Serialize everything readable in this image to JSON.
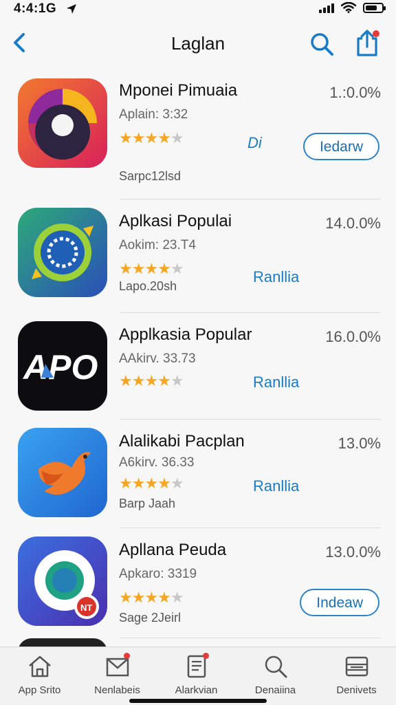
{
  "status": {
    "time": "4:4:1G"
  },
  "nav": {
    "title": "Laglan"
  },
  "apps": [
    {
      "name": "Mponei Pimuaia",
      "subtitle": "Aplain: 3:32",
      "rating": 4,
      "extra": "Sarpc12lsd",
      "size": "1.:0.0%",
      "action_type": "both",
      "action_link": "Di",
      "action_button": "Iedarw"
    },
    {
      "name": "Aplkasi Populai",
      "subtitle": "Aokim: 23.T4",
      "rating": 4,
      "extra": "Lapo.20sh",
      "size": "14.0.0%",
      "action_type": "link",
      "action_link": "Ranllia",
      "action_button": ""
    },
    {
      "name": "Applkasia Popular",
      "subtitle": "AAkirv. 33.73",
      "rating": 4,
      "extra": "",
      "size": "16.0.0%",
      "action_type": "link",
      "action_link": "Ranllia",
      "action_button": ""
    },
    {
      "name": "Alalikabi Pacplan",
      "subtitle": "A6kirv. 36.33",
      "rating": 4,
      "extra": "Barp Jaah",
      "size": "13.0%",
      "action_type": "link",
      "action_link": "Ranllia",
      "action_button": ""
    },
    {
      "name": "Apllana Peuda",
      "subtitle": "Apkaro: 3319",
      "rating": 4,
      "extra": "Sage 2Jeirl",
      "size": "13.0.0%",
      "action_type": "button",
      "action_link": "",
      "action_button": "Indeaw"
    }
  ],
  "tabs": [
    {
      "label": "App Srito",
      "icon": "home-icon",
      "badge": false
    },
    {
      "label": "Nenlabeis",
      "icon": "mail-icon",
      "badge": true
    },
    {
      "label": "Alarkvian",
      "icon": "document-icon",
      "badge": true
    },
    {
      "label": "Denaiina",
      "icon": "search-icon",
      "badge": false
    },
    {
      "label": "Denivets",
      "icon": "list-icon",
      "badge": false
    }
  ],
  "colors": {
    "accent": "#1a7bc4",
    "star": "#f5a623",
    "badge": "#e53b3b"
  }
}
